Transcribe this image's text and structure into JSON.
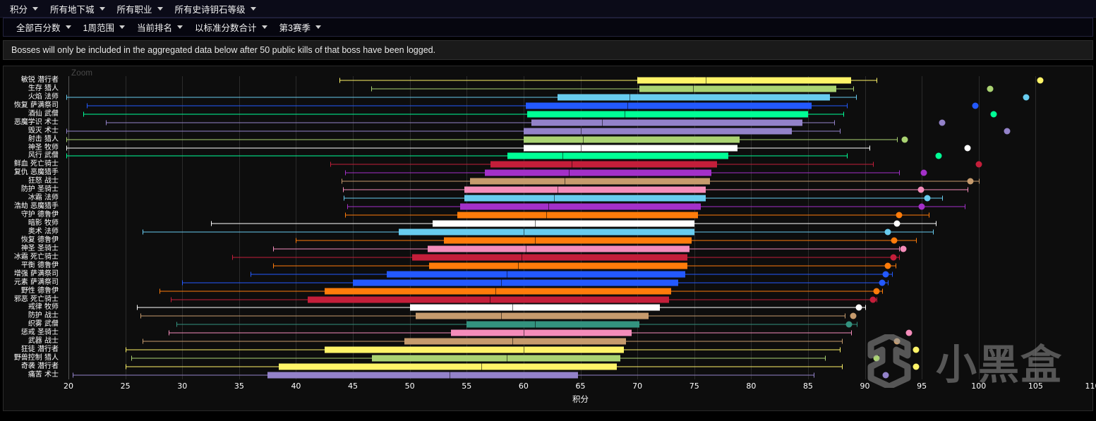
{
  "nav": {
    "primary": [
      {
        "label": "积分",
        "caret": true
      },
      {
        "label": "所有地下城",
        "caret": true
      },
      {
        "label": "所有职业",
        "caret": true
      },
      {
        "label": "所有史诗钥石等级",
        "caret": true
      }
    ],
    "secondary": [
      {
        "label": "全部百分数",
        "caret": true
      },
      {
        "label": "1周范围",
        "caret": true
      },
      {
        "label": "当前排名",
        "caret": true
      },
      {
        "label": "以标准分数合计",
        "caret": true
      },
      {
        "label": "第3赛季",
        "caret": true
      }
    ]
  },
  "alert": {
    "text": "Bosses will only be included in the aggregated data below after 50 public kills of that boss have been logged."
  },
  "chart_panel": {
    "zoom_label": "Zoom",
    "watermark_text": "小黑盒"
  },
  "chart_data": {
    "type": "box",
    "title": "",
    "xlabel": "积分",
    "ylabel": "",
    "xlim": [
      20,
      110
    ],
    "xticks": [
      20,
      25,
      30,
      35,
      40,
      45,
      50,
      55,
      60,
      65,
      70,
      75,
      80,
      85,
      90,
      95,
      100,
      105,
      110
    ],
    "grid": true,
    "legend": "none",
    "colors": {
      "rogue": "#fff468",
      "hunter_green": "#aad372",
      "mage": "#68ccef",
      "shaman": "#2359ff",
      "monk": "#00ff96",
      "warlock": "#9382c9",
      "priest": "#ffffff",
      "dk": "#c41e3a",
      "dh": "#a330c9",
      "warrior": "#c69b6d",
      "druid": "#ff7c0a",
      "paladin": "#f48cba",
      "evoker": "#33937f"
    },
    "categories": [
      "敏锐 潜行者",
      "生存 猎人",
      "火焰 法师",
      "恢复 萨满祭司",
      "酒仙 武僧",
      "恶魔学识 术士",
      "毁灭 术士",
      "射击 猎人",
      "神圣 牧师",
      "风行 武僧",
      "鲜血 死亡骑士",
      "复仇 恶魔猎手",
      "狂怒 战士",
      "防护 圣骑士",
      "冰霜 法师",
      "浩劫 恶魔猎手",
      "守护 德鲁伊",
      "暗影 牧师",
      "奥术 法师",
      "恢复 德鲁伊",
      "神圣 圣骑士",
      "冰霜 死亡骑士",
      "平衡 德鲁伊",
      "增强 萨满祭司",
      "元素 萨满祭司",
      "野性 德鲁伊",
      "邪恶 死亡骑士",
      "戒律 牧师",
      "防护 战士",
      "织雾 武僧",
      "惩戒 圣骑士",
      "武器 战士",
      "狂徒 潜行者",
      "野兽控制 猎人",
      "奇袭 潜行者",
      "痛苦 术士"
    ],
    "series": [
      {
        "name": "敏锐 潜行者",
        "color": "#fff468",
        "whisker_low": 43.8,
        "q1": 70.0,
        "median": 76.0,
        "q3": 88.8,
        "whisker_high": 91.0,
        "outliers": [
          105.4
        ]
      },
      {
        "name": "生存 猎人",
        "color": "#aad372",
        "whisker_low": 46.6,
        "q1": 70.2,
        "median": 74.9,
        "q3": 87.5,
        "whisker_high": 89.0,
        "outliers": [
          101.0
        ]
      },
      {
        "name": "火焰 法师",
        "color": "#68ccef",
        "whisker_low": 19.8,
        "q1": 63.0,
        "median": 69.3,
        "q3": 86.9,
        "whisker_high": 89.2,
        "outliers": [
          104.2
        ]
      },
      {
        "name": "恢复 萨满祭司",
        "color": "#2359ff",
        "whisker_low": 21.6,
        "q1": 60.2,
        "median": 69.1,
        "q3": 85.3,
        "whisker_high": 88.4,
        "outliers": [
          99.7
        ]
      },
      {
        "name": "酒仙 武僧",
        "color": "#00ff96",
        "whisker_low": 21.3,
        "q1": 60.3,
        "median": 68.9,
        "q3": 85.0,
        "whisker_high": 88.1,
        "outliers": [
          101.3
        ]
      },
      {
        "name": "恶魔学识 术士",
        "color": "#9382c9",
        "whisker_low": 23.3,
        "q1": 60.7,
        "median": 66.9,
        "q3": 84.5,
        "whisker_high": 87.3,
        "outliers": [
          96.8
        ]
      },
      {
        "name": "毁灭 术士",
        "color": "#9382c9",
        "whisker_low": 19.8,
        "q1": 60.0,
        "median": 65.0,
        "q3": 83.6,
        "whisker_high": 87.8,
        "outliers": [
          102.5
        ]
      },
      {
        "name": "射击 猎人",
        "color": "#aad372",
        "whisker_low": 19.8,
        "q1": 60.0,
        "median": 65.2,
        "q3": 79.0,
        "whisker_high": 92.8,
        "outliers": [
          93.5
        ]
      },
      {
        "name": "神圣 牧师",
        "color": "#ffffff",
        "whisker_low": 19.8,
        "q1": 60.0,
        "median": 65.0,
        "q3": 78.8,
        "whisker_high": 90.4,
        "outliers": [
          99.0
        ]
      },
      {
        "name": "风行 武僧",
        "color": "#00ff96",
        "whisker_low": 19.8,
        "q1": 58.6,
        "median": 63.4,
        "q3": 78.0,
        "whisker_high": 88.4,
        "outliers": [
          96.5
        ]
      },
      {
        "name": "鲜血 死亡骑士",
        "color": "#c41e3a",
        "whisker_low": 43.0,
        "q1": 57.1,
        "median": 64.2,
        "q3": 77.0,
        "whisker_high": 90.7,
        "outliers": [
          100.0
        ]
      },
      {
        "name": "复仇 恶魔猎手",
        "color": "#a330c9",
        "whisker_low": 44.3,
        "q1": 56.6,
        "median": 64.0,
        "q3": 76.5,
        "whisker_high": 93.0,
        "outliers": [
          95.2
        ]
      },
      {
        "name": "狂怒 战士",
        "color": "#c69b6d",
        "whisker_low": 44.0,
        "q1": 55.3,
        "median": 63.6,
        "q3": 76.4,
        "whisker_high": 100.0,
        "outliers": [
          99.3
        ]
      },
      {
        "name": "防护 圣骑士",
        "color": "#f48cba",
        "whisker_low": 44.1,
        "q1": 54.8,
        "median": 63.0,
        "q3": 76.0,
        "whisker_high": 99.0,
        "outliers": [
          94.9
        ]
      },
      {
        "name": "冰霜 法师",
        "color": "#68ccef",
        "whisker_low": 44.2,
        "q1": 54.8,
        "median": 62.7,
        "q3": 76.0,
        "whisker_high": 96.8,
        "outliers": [
          95.5
        ]
      },
      {
        "name": "浩劫 恶魔猎手",
        "color": "#a330c9",
        "whisker_low": 44.5,
        "q1": 54.4,
        "median": 62.2,
        "q3": 75.6,
        "whisker_high": 98.8,
        "outliers": [
          95.0
        ]
      },
      {
        "name": "守护 德鲁伊",
        "color": "#ff7c0a",
        "whisker_low": 44.3,
        "q1": 54.2,
        "median": 62.0,
        "q3": 75.3,
        "whisker_high": 95.6,
        "outliers": [
          93.0
        ]
      },
      {
        "name": "暗影 牧师",
        "color": "#ffffff",
        "whisker_low": 32.5,
        "q1": 52.0,
        "median": 61.0,
        "q3": 75.0,
        "whisker_high": 96.2,
        "outliers": [
          92.8
        ]
      },
      {
        "name": "奥术 法师",
        "color": "#68ccef",
        "whisker_low": 26.5,
        "q1": 49.0,
        "median": 60.0,
        "q3": 75.0,
        "whisker_high": 96.0,
        "outliers": [
          92.0
        ]
      },
      {
        "name": "恢复 德鲁伊",
        "color": "#ff7c0a",
        "whisker_low": 40.0,
        "q1": 53.0,
        "median": 61.0,
        "q3": 74.8,
        "whisker_high": 94.5,
        "outliers": [
          92.6
        ]
      },
      {
        "name": "神圣 圣骑士",
        "color": "#f48cba",
        "whisker_low": 38.0,
        "q1": 51.6,
        "median": 60.2,
        "q3": 74.6,
        "whisker_high": 93.0,
        "outliers": [
          93.4
        ]
      },
      {
        "name": "冰霜 死亡骑士",
        "color": "#c41e3a",
        "whisker_low": 34.4,
        "q1": 50.2,
        "median": 59.8,
        "q3": 74.4,
        "whisker_high": 93.0,
        "outliers": [
          92.5
        ]
      },
      {
        "name": "平衡 德鲁伊",
        "color": "#ff7c0a",
        "whisker_low": 38.0,
        "q1": 51.7,
        "median": 59.5,
        "q3": 74.4,
        "whisker_high": 92.7,
        "outliers": [
          92.0
        ]
      },
      {
        "name": "增强 萨满祭司",
        "color": "#2359ff",
        "whisker_low": 36.0,
        "q1": 48.0,
        "median": 58.5,
        "q3": 74.2,
        "whisker_high": 92.4,
        "outliers": [
          91.8
        ]
      },
      {
        "name": "元素 萨满祭司",
        "color": "#2359ff",
        "whisker_low": 30.0,
        "q1": 45.0,
        "median": 58.0,
        "q3": 73.6,
        "whisker_high": 92.0,
        "outliers": [
          91.5
        ]
      },
      {
        "name": "野性 德鲁伊",
        "color": "#ff7c0a",
        "whisker_low": 28.0,
        "q1": 42.5,
        "median": 57.5,
        "q3": 73.0,
        "whisker_high": 91.5,
        "outliers": [
          91.0
        ]
      },
      {
        "name": "邪恶 死亡骑士",
        "color": "#c41e3a",
        "whisker_low": 29.0,
        "q1": 41.0,
        "median": 57.0,
        "q3": 72.8,
        "whisker_high": 91.0,
        "outliers": [
          90.7
        ]
      },
      {
        "name": "戒律 牧师",
        "color": "#ffffff",
        "whisker_low": 26.0,
        "q1": 50.0,
        "median": 59.0,
        "q3": 72.0,
        "whisker_high": 90.0,
        "outliers": [
          89.5
        ]
      },
      {
        "name": "防护 战士",
        "color": "#c69b6d",
        "whisker_low": 26.3,
        "q1": 50.5,
        "median": 58.0,
        "q3": 71.0,
        "whisker_high": 88.2,
        "outliers": [
          89.0
        ]
      },
      {
        "name": "织雾 武僧",
        "color": "#33937f",
        "whisker_low": 29.5,
        "q1": 55.0,
        "median": 61.0,
        "q3": 70.2,
        "whisker_high": 89.3,
        "outliers": [
          88.6
        ]
      },
      {
        "name": "惩戒 圣骑士",
        "color": "#f48cba",
        "whisker_low": 28.8,
        "q1": 53.6,
        "median": 60.0,
        "q3": 69.5,
        "whisker_high": 88.8,
        "outliers": [
          93.9
        ]
      },
      {
        "name": "武器 战士",
        "color": "#c69b6d",
        "whisker_low": 26.5,
        "q1": 49.5,
        "median": 59.0,
        "q3": 69.0,
        "whisker_high": 88.0,
        "outliers": [
          92.8
        ]
      },
      {
        "name": "狂徒 潜行者",
        "color": "#fff468",
        "whisker_low": 25.0,
        "q1": 42.5,
        "median": 60.0,
        "q3": 68.8,
        "whisker_high": 87.8,
        "outliers": [
          94.5
        ]
      },
      {
        "name": "野兽控制 猎人",
        "color": "#aad372",
        "whisker_low": 25.5,
        "q1": 46.7,
        "median": 58.5,
        "q3": 68.5,
        "whisker_high": 86.5,
        "outliers": [
          91.0
        ]
      },
      {
        "name": "奇袭 潜行者",
        "color": "#fff468",
        "whisker_low": 25.0,
        "q1": 38.5,
        "median": 56.3,
        "q3": 68.2,
        "whisker_high": 88.0,
        "outliers": [
          94.5
        ]
      },
      {
        "name": "痛苦 术士",
        "color": "#9382c9",
        "whisker_low": 20.4,
        "q1": 37.5,
        "median": 53.5,
        "q3": 64.8,
        "whisker_high": 85.5,
        "outliers": [
          91.8
        ]
      }
    ]
  }
}
